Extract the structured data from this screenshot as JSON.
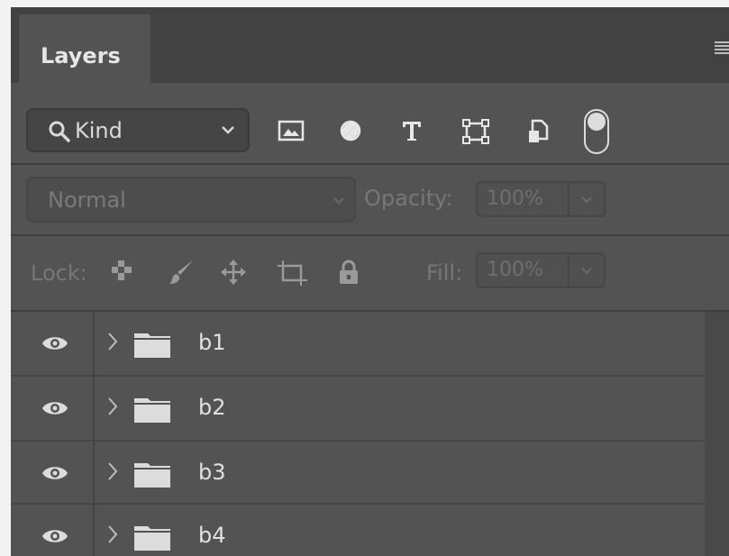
{
  "panel": {
    "tab_label": "Layers",
    "menu_icon": "panel-menu-icon"
  },
  "filter": {
    "kind_label": "Kind",
    "icons": [
      "image-filter-icon",
      "adjustment-filter-icon",
      "type-filter-icon",
      "shape-filter-icon",
      "smart-object-filter-icon"
    ],
    "toggle_state": "on"
  },
  "blend": {
    "mode": "Normal",
    "opacity_label": "Opacity:",
    "opacity_value": "100%"
  },
  "lock": {
    "label": "Lock:",
    "icons": [
      "lock-transparent-pixels-icon",
      "lock-image-pixels-icon",
      "lock-position-icon",
      "lock-artboard-icon",
      "lock-all-icon"
    ],
    "fill_label": "Fill:",
    "fill_value": "100%"
  },
  "layers": [
    {
      "name": "b1",
      "type": "group",
      "visible": true
    },
    {
      "name": "b2",
      "type": "group",
      "visible": true
    },
    {
      "name": "b3",
      "type": "group",
      "visible": true
    },
    {
      "name": "b4",
      "type": "group",
      "visible": true
    }
  ],
  "colors": {
    "panel_bg": "#535353",
    "tabbar_bg": "#424242",
    "text": "#e0e0e0",
    "disabled_text": "#777777"
  }
}
